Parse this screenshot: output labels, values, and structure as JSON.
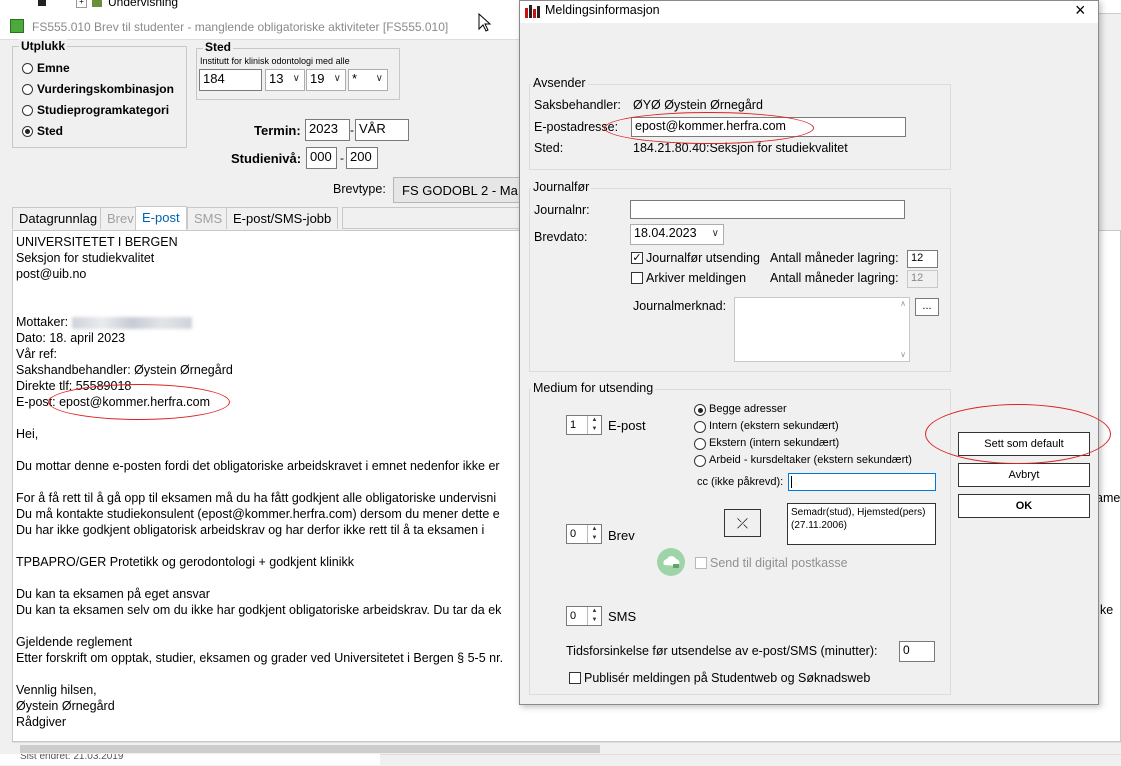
{
  "back_window": {
    "title": "FS555.010 Brev til studenter - manglende obligatoriske aktiviteter [FS555.010]",
    "top_tree_item": "Undervisning",
    "utplukk": {
      "legend": "Utplukk",
      "options": [
        "Emne",
        "Vurderingskombinasjon",
        "Studieprogramkategori",
        "Sted"
      ],
      "selected": "Sted"
    },
    "sted": {
      "legend": "Sted",
      "description": "Institutt for klinisk odontologi med alle",
      "code1": "184",
      "code2": "13",
      "code3": "19",
      "code4": "*"
    },
    "termin": {
      "label": "Termin:",
      "year": "2023",
      "season": "VÅR"
    },
    "studieniva": {
      "label": "Studienivå:",
      "from": "000",
      "to": "200"
    },
    "brevtype": {
      "label": "Brevtype:",
      "value": "FS GODOBL 2 - Ma"
    },
    "tabs": [
      {
        "label": "Datagrunnlag",
        "state": "normal"
      },
      {
        "label": "Brev",
        "state": "disabled"
      },
      {
        "label": "E-post",
        "state": "active"
      },
      {
        "label": "SMS",
        "state": "disabled"
      },
      {
        "label": "E-post/SMS-jobb",
        "state": "normal"
      }
    ],
    "letter_lines": [
      "UNIVERSITETET I BERGEN",
      "Seksjon for studiekvalitet",
      "post@uib.no",
      "",
      "",
      "Mottaker:",
      "Dato: 18. april 2023",
      "Vår ref:",
      "Sakshandbehandler: Øystein Ørnegård",
      "Direkte tlf: 55589018",
      "E-post: epost@kommer.herfra.com",
      "",
      "Hei,",
      "",
      "Du mottar denne e-posten fordi det obligatoriske arbeidskravet i emnet nedenfor ikke er",
      "",
      "For å få rett til å gå opp til eksamen må du ha fått godkjent alle obligatoriske undervisni",
      "Du må kontakte studiekonsulent (epost@kommer.herfra.com) dersom du mener dette e",
      "Du har ikke godkjent obligatorisk arbeidskrav og har derfor ikke rett til å ta eksamen i",
      "",
      "TPBAPRO/GER Protetikk og gerodontologi + godkjent klinikk",
      "",
      "Du kan ta eksamen på eget ansvar",
      "Du kan ta eksamen selv om du ikke har godkjent obligatoriske arbeidskrav. Du tar da ek",
      "",
      "Gjeldende reglement",
      "Etter forskrift om opptak, studier, eksamen og grader ved Universitetet i Bergen § 5-5 nr.",
      "",
      "Vennlig hilsen,",
      "Øystein Ørnegård",
      "Rådgiver"
    ],
    "right_overflow_1": "ame",
    "right_overflow_2": "ke",
    "status_bar": "Sist endret: 21.03.2019"
  },
  "dialog": {
    "title": "Meldingsinformasjon",
    "avsender": {
      "legend": "Avsender",
      "saksbehandler_label": "Saksbehandler:",
      "saksbehandler_value": "ØYØ Øystein Ørnegård",
      "epost_label": "E-postadresse:",
      "epost_value": "epost@kommer.herfra.com",
      "sted_label": "Sted:",
      "sted_value": "184.21.80.40:Seksjon for studiekvalitet"
    },
    "journalfor": {
      "legend": "Journalfør",
      "journalnr_label": "Journalnr:",
      "journalnr_value": "",
      "brevdato_label": "Brevdato:",
      "brevdato_value": "18.04.2023",
      "journalfor_utsending_label": "Journalfør utsending",
      "journalfor_utsending_checked": true,
      "arkiver_label": "Arkiver meldingen",
      "arkiver_checked": false,
      "antall_label_1": "Antall måneder lagring:",
      "antall_value_1": "12",
      "antall_label_2": "Antall måneder lagring:",
      "antall_value_2": "12",
      "merknad_label": "Journalmerknad:",
      "merknad_button": "..."
    },
    "medium": {
      "legend": "Medium for utsending",
      "epost_count": "1",
      "epost_label": "E-post",
      "address_options": [
        "Begge adresser",
        "Intern (ekstern sekundært)",
        "Ekstern (intern sekundært)",
        "Arbeid - kursdeltaker (ekstern sekundært)"
      ],
      "address_selected": "Begge adresser",
      "cc_label": "cc (ikke påkrevd):",
      "cc_value": "",
      "brev_count": "0",
      "brev_label": "Brev",
      "address_info": "Semadr(stud), Hjemsted(pers) (27.11.2006)",
      "digital_label": "Send til digital postkasse",
      "sms_count": "0",
      "sms_label": "SMS",
      "delay_label": "Tidsforsinkelse før utsendelse av e-post/SMS (minutter):",
      "delay_value": "0",
      "publiser_label": "Publisér meldingen på Studentweb og Søknadsweb"
    },
    "buttons": {
      "default": "Sett som default",
      "cancel": "Avbryt",
      "ok": "OK"
    },
    "colors": {
      "annotation": "#d22222",
      "active_tab": "#0063b1"
    }
  }
}
